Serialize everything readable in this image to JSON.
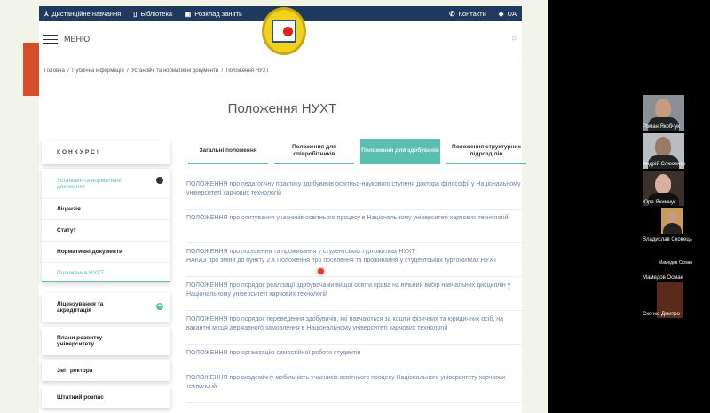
{
  "topbar": {
    "distance": "Дистанційне навчання",
    "library": "Бібліотека",
    "schedule": "Розклад занять",
    "contacts": "Контакти",
    "lang": "UA"
  },
  "header": {
    "menu": "МЕНЮ"
  },
  "breadcrumb": [
    "Головна",
    "Публічна інформація",
    "Установчі та нормативні документи",
    "Положення НУХТ"
  ],
  "page_title": "Положення НУХТ",
  "sidebar": {
    "contest": "КОНКУРС!",
    "group_title": "Установчі та нормативні документи",
    "group_items": [
      "Ліцензія",
      "Статут",
      "Нормативні документи",
      "Положення НУХТ"
    ],
    "sections": [
      "Ліцензування та акредитація",
      "Плани розвитку університету",
      "Звіт ректора",
      "Штатний розпис"
    ]
  },
  "tabs": [
    "Загальні положення",
    "Положення для співробітників",
    "Положення для здобувачів",
    "Положення структурних підрозділів"
  ],
  "documents": [
    "ПОЛОЖЕННЯ про педагогічну практику здобувачів освітньо-наукового ступеня доктора філософії у Національному університеті харчових технологій",
    "ПОЛОЖЕННЯ про опитування учасників освітнього процесу в Національному університеті харчових технологій",
    "ПОЛОЖЕННЯ про поселення та проживання у студентських гуртожитках НУХТ",
    "НАКАЗ про зміни до пункту 2.4 Положення про поселення та проживання у студентських гуртожитках НУХТ",
    "ПОЛОЖЕННЯ про порядок реалізації здобувачами вищої освіти права на вільний вибір навчальних дисциплін у Національному університеті харчових технологій",
    "ПОЛОЖЕННЯ про порядок переведення здобувачів, які навчаються за кошти фізичних та юридичних осіб, на вакантні місця державного замовлення в Національному університеті харчових технологій",
    "ПОЛОЖЕННЯ про організацію самостійної роботи студентів",
    "ПОЛОЖЕННЯ про академічну мобільність учасників освітнього процесу Національного університету харчових технологій"
  ],
  "participants": [
    "Роман Якобчук",
    "Андрій Слюсенко",
    "Юра Якимчук",
    "Владислав Скопець",
    "Мамедов Осман",
    "Мамедов Осман",
    "Скочко Дмитро"
  ],
  "colors": {
    "accent": "#5bbfb0",
    "nav": "#1f3a5c",
    "link": "#6d80a8"
  }
}
